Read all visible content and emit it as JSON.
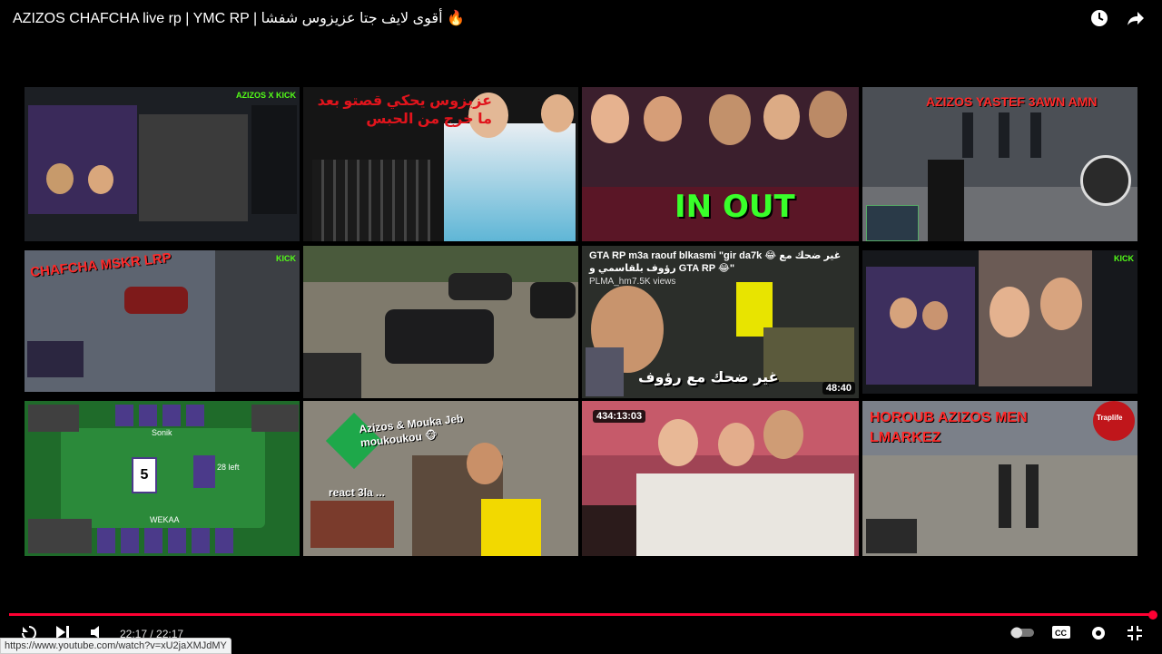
{
  "header": {
    "title": "AZIZOS CHAFCHA live rp | YMC RP | أقوى لايف جتا عزيزوس شفشا 🔥",
    "watch_later_icon": "clock-icon",
    "share_icon": "share-arrow-icon"
  },
  "endscreen": {
    "tiles": [
      {
        "caption": "KICK",
        "logo": "AZIZOS X KICK"
      },
      {
        "caption": "عزيزوس يحكي قصتو بعد ما خرج من الحبس"
      },
      {
        "caption": "IN OUT"
      },
      {
        "caption": "AZIZOS YASTEF 3AWN AMN"
      },
      {
        "caption": "CHAFCHA MSKR LRP"
      },
      {
        "caption": ""
      },
      {
        "caption": "GTA RP m3a raouf blkasmi \"gir da7k 😂 غير ضحك مع رؤوف بلقاسمي و GTA RP 😂\"",
        "channel": "PLMA_hm",
        "views": "7.5K views",
        "overlay_text": "غير ضحك مع رؤوف",
        "duration": "48:40"
      },
      {
        "caption": "KICK"
      },
      {
        "caption": "",
        "players": [
          "Sonik",
          "WEKAA"
        ],
        "center_card": "5",
        "cards_left": "28 left"
      },
      {
        "caption": "Azizos & Mouka Jeb moukoukou 🐵",
        "sub": "react 3la ..."
      },
      {
        "caption": "",
        "duration": "434:13:03"
      },
      {
        "caption": "HOROUB AZIZOS MEN LMARKEZ",
        "logo": "Traplife"
      }
    ]
  },
  "controls": {
    "time": "22:17 / 22:17",
    "progress": 1.0,
    "accent": "#ff0033"
  },
  "status_bar": {
    "url": "https://www.youtube.com/watch?v=xU2jaXMJdMY"
  }
}
